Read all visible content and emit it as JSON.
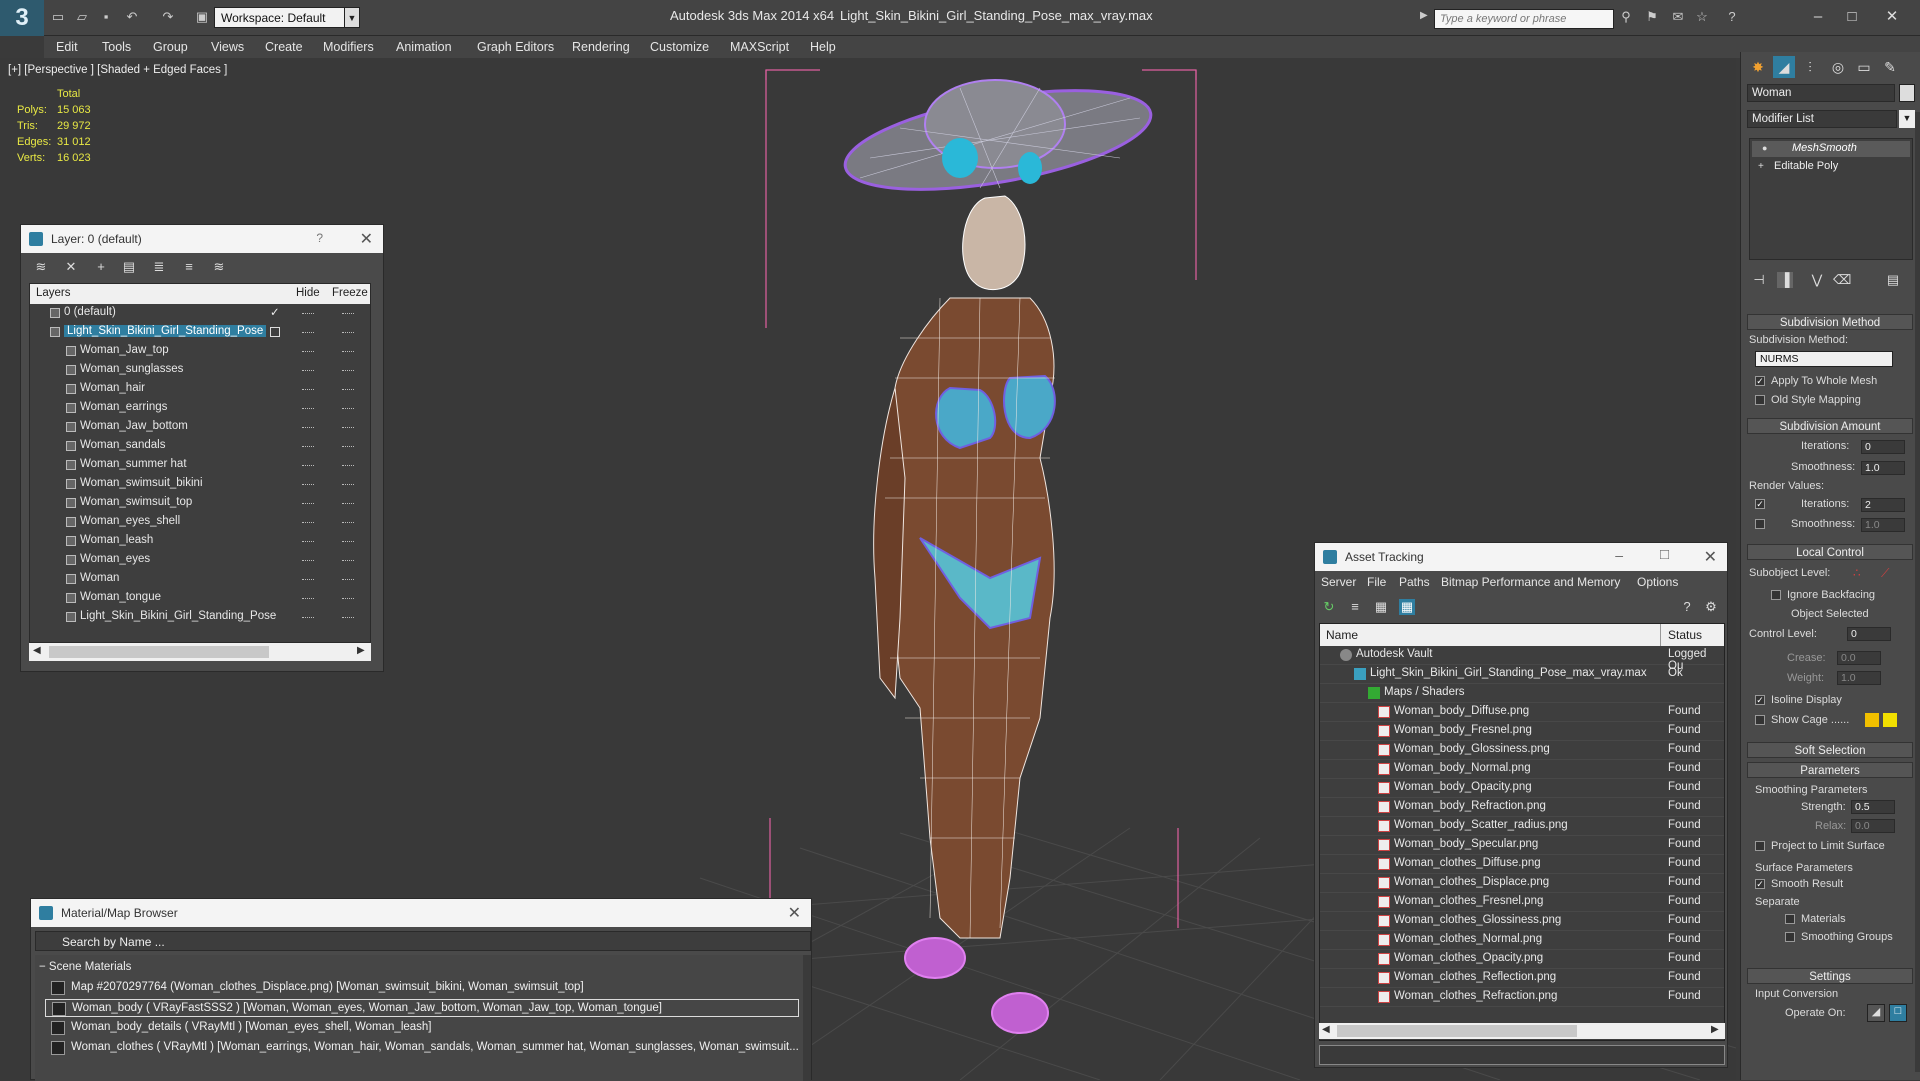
{
  "titlebar": {
    "logo": "3",
    "workspace": "Workspace: Default",
    "app_title": "Autodesk 3ds Max  2014 x64",
    "file_title": "Light_Skin_Bikini_Girl_Standing_Pose_max_vray.max",
    "search_placeholder": "Type a keyword or phrase"
  },
  "menubar": [
    "Edit",
    "Tools",
    "Group",
    "Views",
    "Create",
    "Modifiers",
    "Animation",
    "Graph Editors",
    "Rendering",
    "Customize",
    "MAXScript",
    "Help"
  ],
  "viewport": {
    "label": "[+] [Perspective ] [Shaded + Edged Faces ]",
    "stats_header": "Total",
    "stats": [
      {
        "k": "Polys:",
        "v": "15 063"
      },
      {
        "k": "Tris:",
        "v": "29 972"
      },
      {
        "k": "Edges:",
        "v": "31 012"
      },
      {
        "k": "Verts:",
        "v": "16 023"
      }
    ]
  },
  "layer_panel": {
    "title": "Layer: 0 (default)",
    "help": "?",
    "col_layers": "Layers",
    "col_hide": "Hide",
    "col_freeze": "Freeze",
    "rows": [
      {
        "name": "0 (default)",
        "indent": 1,
        "check": true
      },
      {
        "name": "Light_Skin_Bikini_Girl_Standing_Pose",
        "indent": 1,
        "selected": true
      },
      {
        "name": "Woman_Jaw_top",
        "indent": 2
      },
      {
        "name": "Woman_sunglasses",
        "indent": 2
      },
      {
        "name": "Woman_hair",
        "indent": 2
      },
      {
        "name": "Woman_earrings",
        "indent": 2
      },
      {
        "name": "Woman_Jaw_bottom",
        "indent": 2
      },
      {
        "name": "Woman_sandals",
        "indent": 2
      },
      {
        "name": "Woman_summer hat",
        "indent": 2
      },
      {
        "name": "Woman_swimsuit_bikini",
        "indent": 2
      },
      {
        "name": "Woman_swimsuit_top",
        "indent": 2
      },
      {
        "name": "Woman_eyes_shell",
        "indent": 2
      },
      {
        "name": "Woman_leash",
        "indent": 2
      },
      {
        "name": "Woman_eyes",
        "indent": 2
      },
      {
        "name": "Woman",
        "indent": 2
      },
      {
        "name": "Woman_tongue",
        "indent": 2
      },
      {
        "name": "Light_Skin_Bikini_Girl_Standing_Pose",
        "indent": 2
      }
    ]
  },
  "material_browser": {
    "title": "Material/Map Browser",
    "search_placeholder": "Search by Name ...",
    "section": "Scene Materials",
    "rows": [
      {
        "text": "Map #2070297764 (Woman_clothes_Displace.png) [Woman_swimsuit_bikini, Woman_swimsuit_top]"
      },
      {
        "text": "Woman_body  ( VRayFastSSS2 ) [Woman, Woman_eyes, Woman_Jaw_bottom, Woman_Jaw_top, Woman_tongue]",
        "selected": true
      },
      {
        "text": "Woman_body_details  ( VRayMtl ) [Woman_eyes_shell, Woman_leash]"
      },
      {
        "text": "Woman_clothes  ( VRayMtl ) [Woman_earrings, Woman_hair, Woman_sandals, Woman_summer hat, Woman_sunglasses, Woman_swimsuit..."
      }
    ]
  },
  "asset_tracking": {
    "title": "Asset Tracking",
    "menu": [
      "Server",
      "File",
      "Paths",
      "Bitmap Performance and Memory",
      "Options"
    ],
    "col_name": "Name",
    "col_status": "Status",
    "rows": [
      {
        "name": "Autodesk Vault",
        "status": "Logged Ou",
        "indent": 1,
        "icon": "vault"
      },
      {
        "name": "Light_Skin_Bikini_Girl_Standing_Pose_max_vray.max",
        "status": "Ok",
        "indent": 2,
        "icon": "max"
      },
      {
        "name": "Maps / Shaders",
        "status": "",
        "indent": 3,
        "icon": "maps"
      },
      {
        "name": "Woman_body_Diffuse.png",
        "status": "Found",
        "indent": 4,
        "icon": "png"
      },
      {
        "name": "Woman_body_Fresnel.png",
        "status": "Found",
        "indent": 4,
        "icon": "png"
      },
      {
        "name": "Woman_body_Glossiness.png",
        "status": "Found",
        "indent": 4,
        "icon": "png"
      },
      {
        "name": "Woman_body_Normal.png",
        "status": "Found",
        "indent": 4,
        "icon": "png"
      },
      {
        "name": "Woman_body_Opacity.png",
        "status": "Found",
        "indent": 4,
        "icon": "png"
      },
      {
        "name": "Woman_body_Refraction.png",
        "status": "Found",
        "indent": 4,
        "icon": "png"
      },
      {
        "name": "Woman_body_Scatter_radius.png",
        "status": "Found",
        "indent": 4,
        "icon": "png"
      },
      {
        "name": "Woman_body_Specular.png",
        "status": "Found",
        "indent": 4,
        "icon": "png"
      },
      {
        "name": "Woman_clothes_Diffuse.png",
        "status": "Found",
        "indent": 4,
        "icon": "png"
      },
      {
        "name": "Woman_clothes_Displace.png",
        "status": "Found",
        "indent": 4,
        "icon": "png"
      },
      {
        "name": "Woman_clothes_Fresnel.png",
        "status": "Found",
        "indent": 4,
        "icon": "png"
      },
      {
        "name": "Woman_clothes_Glossiness.png",
        "status": "Found",
        "indent": 4,
        "icon": "png"
      },
      {
        "name": "Woman_clothes_Normal.png",
        "status": "Found",
        "indent": 4,
        "icon": "png"
      },
      {
        "name": "Woman_clothes_Opacity.png",
        "status": "Found",
        "indent": 4,
        "icon": "png"
      },
      {
        "name": "Woman_clothes_Reflection.png",
        "status": "Found",
        "indent": 4,
        "icon": "png"
      },
      {
        "name": "Woman_clothes_Refraction.png",
        "status": "Found",
        "indent": 4,
        "icon": "png"
      }
    ]
  },
  "command_panel": {
    "object_name": "Woman",
    "modifier_list": "Modifier List",
    "stack": [
      "MeshSmooth",
      "Editable Poly"
    ],
    "subdivision_method_title": "Subdivision Method",
    "subdivision_method_label": "Subdivision Method:",
    "subdivision_method_value": "NURMS",
    "apply_whole_mesh": "Apply To Whole Mesh",
    "old_style_mapping": "Old Style Mapping",
    "subdivision_amount_title": "Subdivision Amount",
    "iterations_label": "Iterations:",
    "iterations_value": "0",
    "smoothness_label": "Smoothness:",
    "smoothness_value": "1.0",
    "render_values": "Render Values:",
    "render_iterations_value": "2",
    "render_smoothness_value": "1.0",
    "local_control_title": "Local Control",
    "subobject_level": "Subobject Level:",
    "ignore_backfacing": "Ignore Backfacing",
    "object_selected": "Object Selected",
    "control_level_label": "Control Level:",
    "control_level_value": "0",
    "crease_label": "Crease:",
    "crease_value": "0.0",
    "weight_label": "Weight:",
    "weight_value": "1.0",
    "isoline_display": "Isoline Display",
    "show_cage": "Show Cage ......",
    "soft_selection_title": "Soft Selection",
    "parameters_title": "Parameters",
    "smoothing_parameters": "Smoothing Parameters",
    "strength_label": "Strength:",
    "strength_value": "0.5",
    "relax_label": "Relax:",
    "relax_value": "0.0",
    "project_limit": "Project to Limit Surface",
    "surface_parameters": "Surface Parameters",
    "smooth_result": "Smooth Result",
    "separate": "Separate",
    "materials": "Materials",
    "smoothing_groups": "Smoothing Groups",
    "settings_title": "Settings",
    "input_conversion": "Input Conversion",
    "operate_on": "Operate On:"
  },
  "colors": {
    "accent": "#2f7ea0",
    "stat_yellow": "#e8e844",
    "cage_yellow": "#f2c000"
  }
}
